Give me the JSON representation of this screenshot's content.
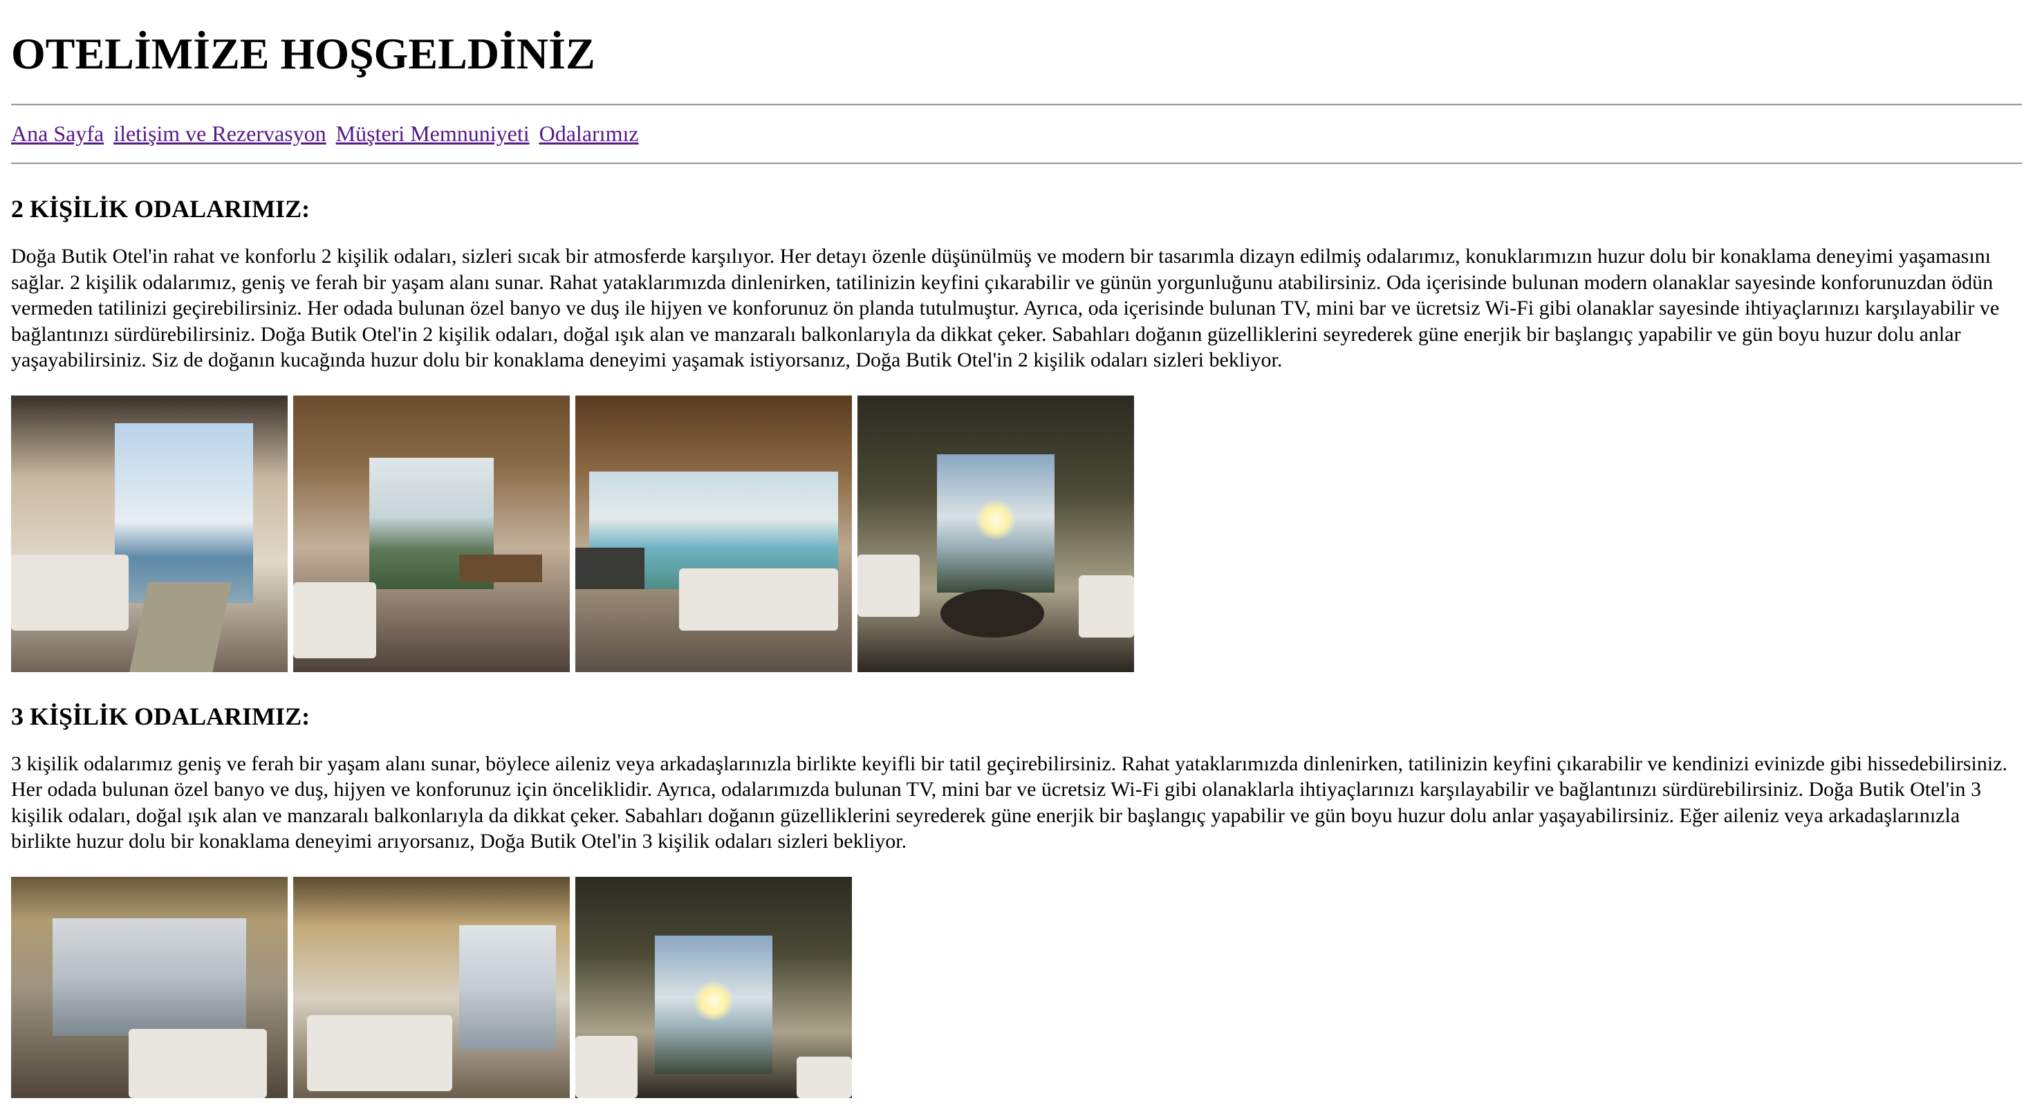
{
  "header": {
    "title": "OTELİMİZE HOŞGELDİNİZ"
  },
  "nav": {
    "items": [
      {
        "label": "Ana Sayfa"
      },
      {
        "label": "iletişim ve Rezervasyon"
      },
      {
        "label": "Müşteri Memnuniyeti"
      },
      {
        "label": "Odalarımız"
      }
    ]
  },
  "sections": [
    {
      "heading": "2 KİŞİLİK ODALARIMIZ:",
      "text": "Doğa Butik Otel'in rahat ve konforlu 2 kişilik odaları, sizleri sıcak bir atmosferde karşılıyor. Her detayı özenle düşünülmüş ve modern bir tasarımla dizayn edilmiş odalarımız, konuklarımızın huzur dolu bir konaklama deneyimi yaşamasını sağlar. 2 kişilik odalarımız, geniş ve ferah bir yaşam alanı sunar. Rahat yataklarımızda dinlenirken, tatilinizin keyfini çıkarabilir ve günün yorgunluğunu atabilirsiniz. Oda içerisinde bulunan modern olanaklar sayesinde konforunuzdan ödün vermeden tatilinizi geçirebilirsiniz. Her odada bulunan özel banyo ve duş ile hijyen ve konforunuz ön planda tutulmuştur. Ayrıca, oda içerisinde bulunan TV, mini bar ve ücretsiz Wi-Fi gibi olanaklar sayesinde ihtiyaçlarınızı karşılayabilir ve bağlantınızı sürdürebilirsiniz. Doğa Butik Otel'in 2 kişilik odaları, doğal ışık alan ve manzaralı balkonlarıyla da dikkat çeker. Sabahları doğanın güzelliklerini seyrederek güne enerjik bir başlangıç yapabilir ve gün boyu huzur dolu anlar yaşayabilirsiniz. Siz de doğanın kucağında huzur dolu bir konaklama deneyimi yaşamak istiyorsanız, Doğa Butik Otel'in 2 kişilik odaları sizleri bekliyor."
    },
    {
      "heading": "3 KİŞİLİK ODALARIMIZ:",
      "text": "3 kişilik odalarımız geniş ve ferah bir yaşam alanı sunar, böylece aileniz veya arkadaşlarınızla birlikte keyifli bir tatil geçirebilirsiniz. Rahat yataklarımızda dinlenirken, tatilinizin keyfini çıkarabilir ve kendinizi evinizde gibi hissedebilirsiniz. Her odada bulunan özel banyo ve duş, hijyen ve konforunuz için önceliklidir. Ayrıca, odalarımızda bulunan TV, mini bar ve ücretsiz Wi-Fi gibi olanaklarla ihtiyaçlarınızı karşılayabilir ve bağlantınızı sürdürebilirsiniz. Doğa Butik Otel'in 3 kişilik odaları, doğal ışık alan ve manzaralı balkonlarıyla da dikkat çeker. Sabahları doğanın güzelliklerini seyrederek güne enerjik bir başlangıç yapabilir ve gün boyu huzur dolu anlar yaşayabilirsiniz. Eğer aileniz veya arkadaşlarınızla birlikte huzur dolu bir konaklama deneyimi arıyorsanız, Doğa Butik Otel'in 3 kişilik odaları sizleri bekliyor."
    }
  ],
  "colors": {
    "link": "#551a8b",
    "rule": "#9a9a9a",
    "text": "#000000",
    "background": "#ffffff"
  }
}
